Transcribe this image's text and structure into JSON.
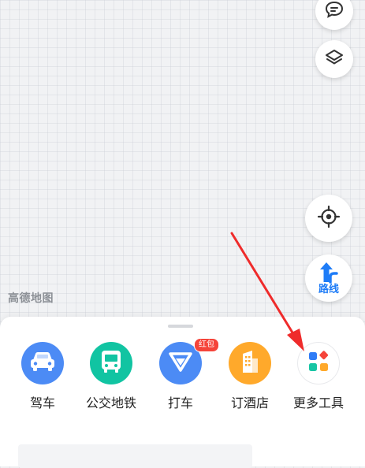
{
  "map": {
    "logo_text": "高德地图",
    "route_label": "路线"
  },
  "services": [
    {
      "id": "drive",
      "label": "驾车",
      "color": "#4c8bf5",
      "icon": "car-icon"
    },
    {
      "id": "transit",
      "label": "公交地铁",
      "color": "#11c4a2",
      "icon": "bus-icon"
    },
    {
      "id": "taxi",
      "label": "打车",
      "color": "#4c8bf5",
      "icon": "taxi-v-icon",
      "badge": "红包"
    },
    {
      "id": "hotel",
      "label": "订酒店",
      "color": "#ffa92b",
      "icon": "hotel-building-icon"
    },
    {
      "id": "more",
      "label": "更多工具",
      "color": "#ffffff",
      "icon": "grid-tiles-icon"
    }
  ],
  "colors": {
    "accent_blue": "#1e7cf7",
    "annotation_red": "#ef2b2b"
  }
}
